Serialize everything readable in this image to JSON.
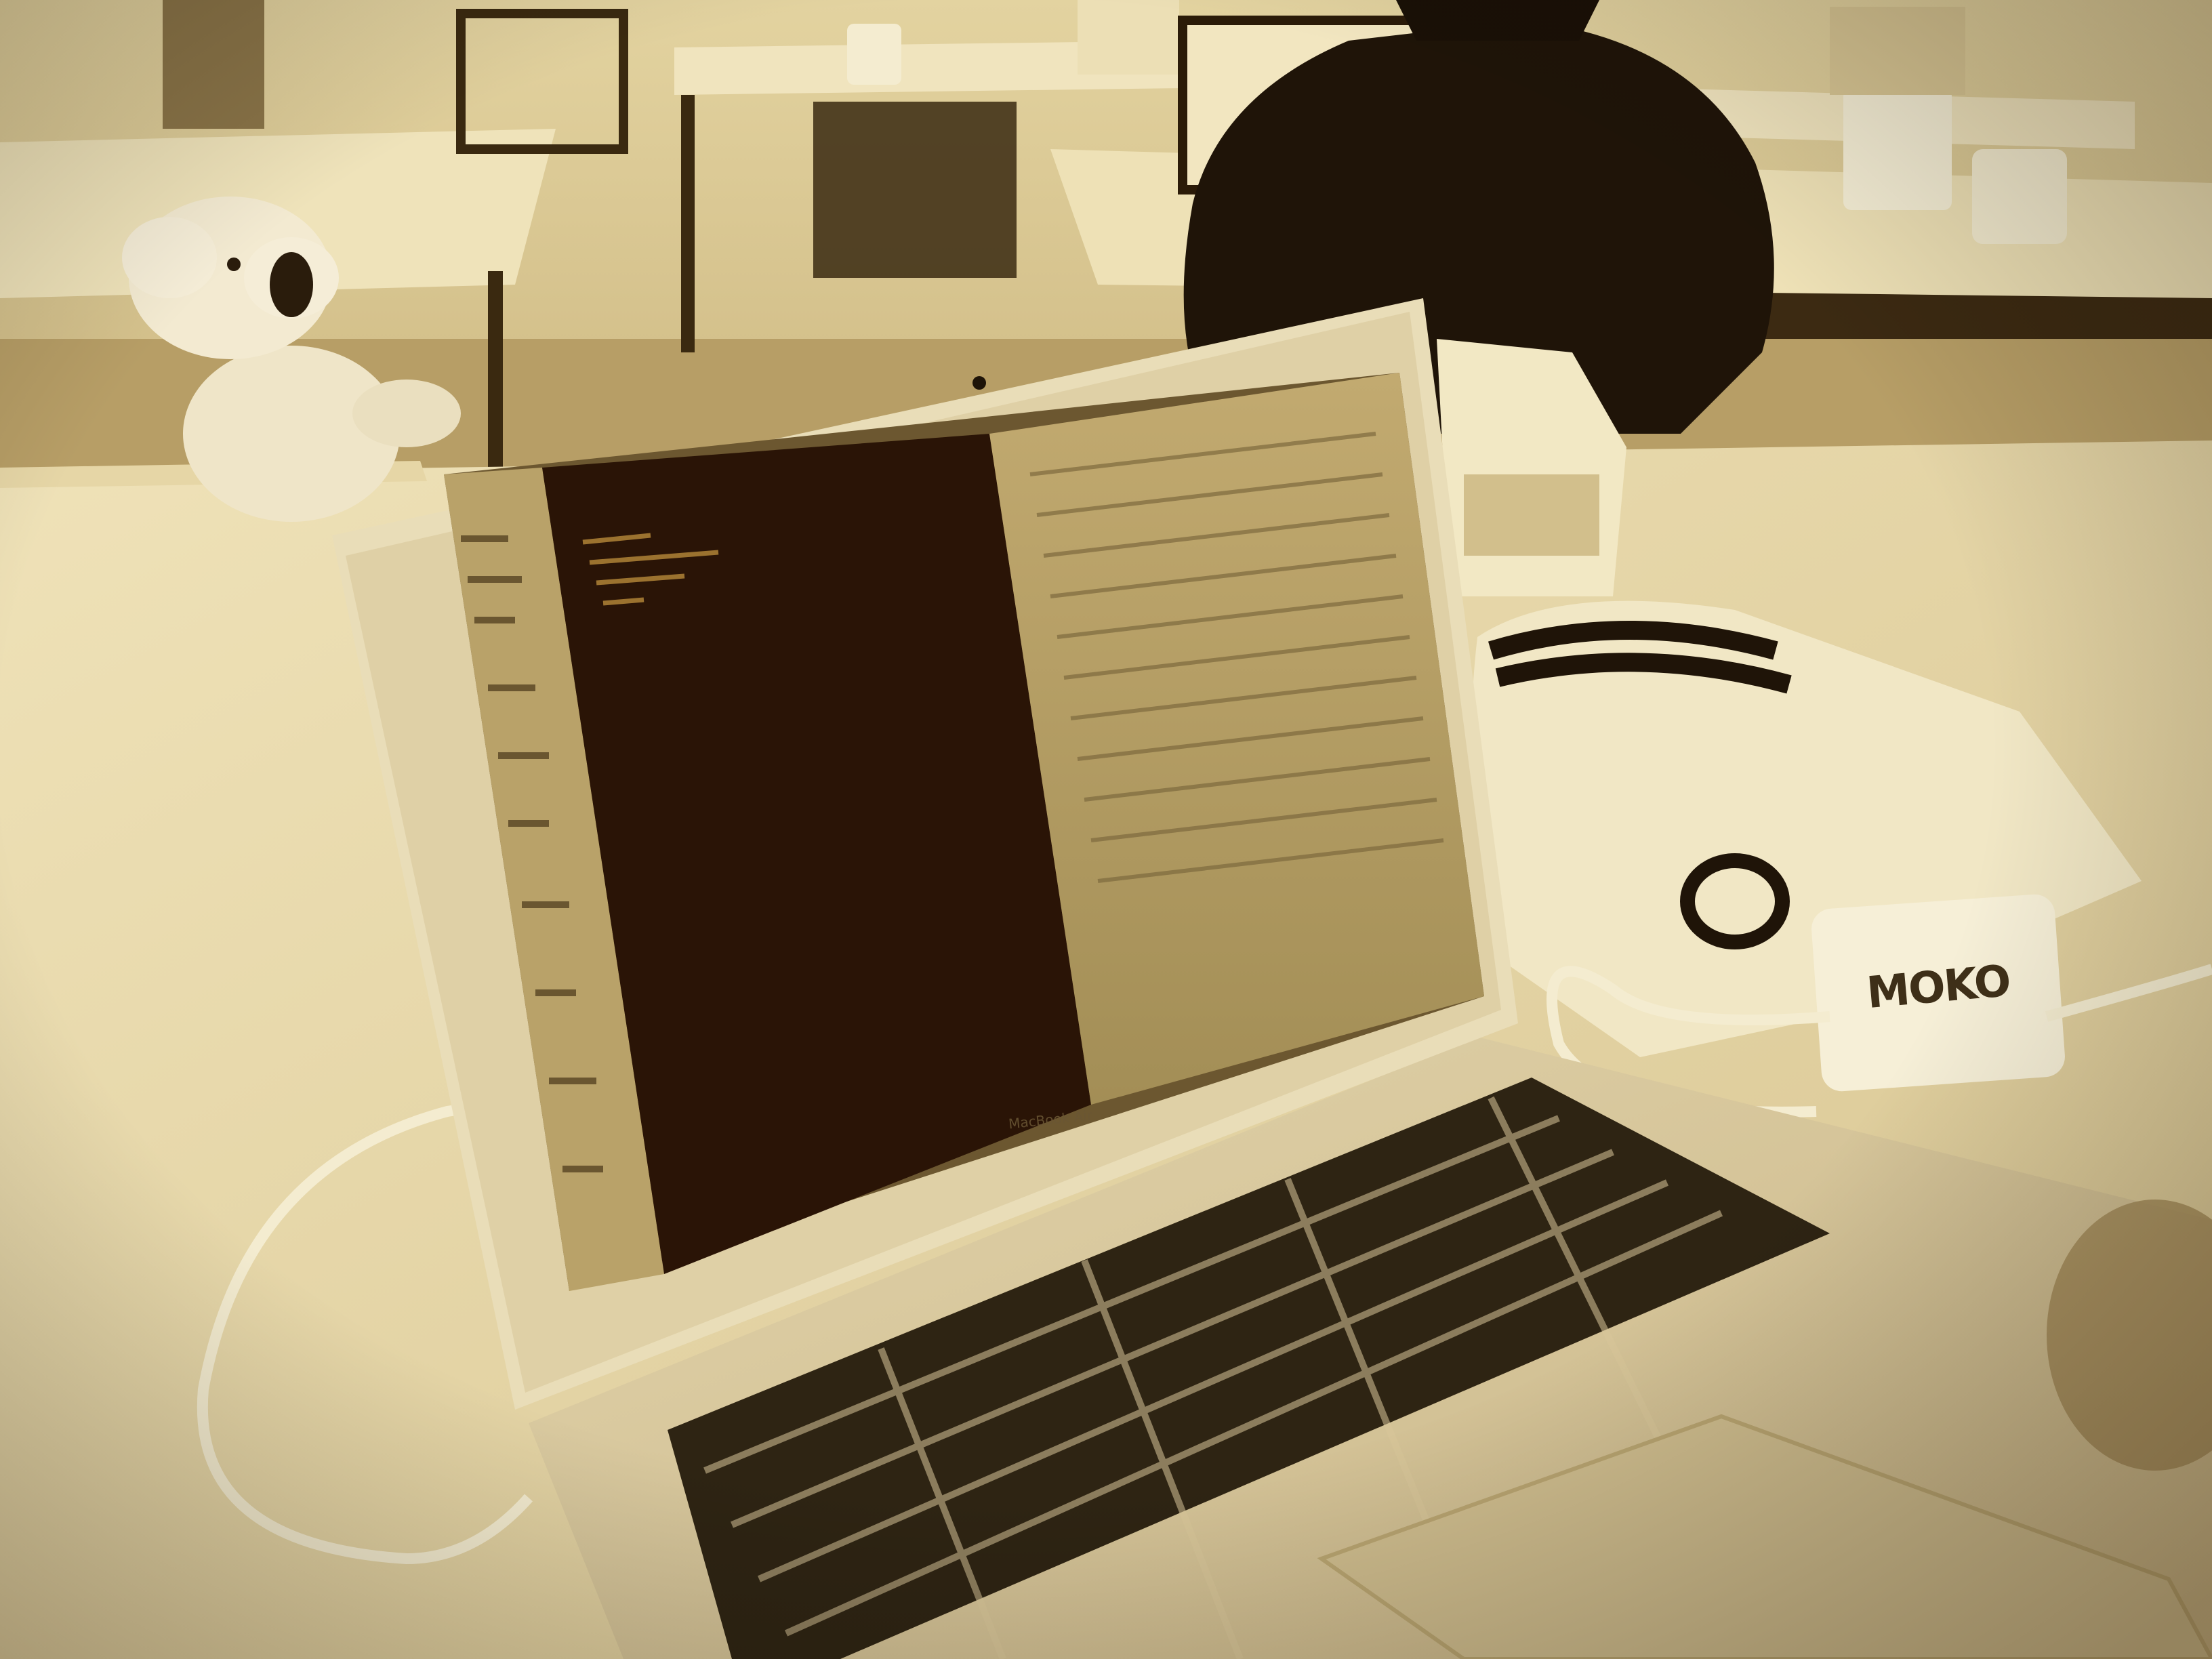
{
  "photo": {
    "tone": "sepia",
    "colors": {
      "wall": "#d9c58f",
      "table": "#efe2b8",
      "screen_dark": "#2a1406",
      "screen_light": "#b9a269",
      "laptop_body": "#d8c8a0",
      "keys": "#2b2012"
    }
  },
  "laptop": {
    "model_label": "MacBook Air",
    "screen_icon": "code-editor-window"
  },
  "charger": {
    "label": "MOKO"
  },
  "toy": {
    "icon": "koala-plush-icon"
  }
}
